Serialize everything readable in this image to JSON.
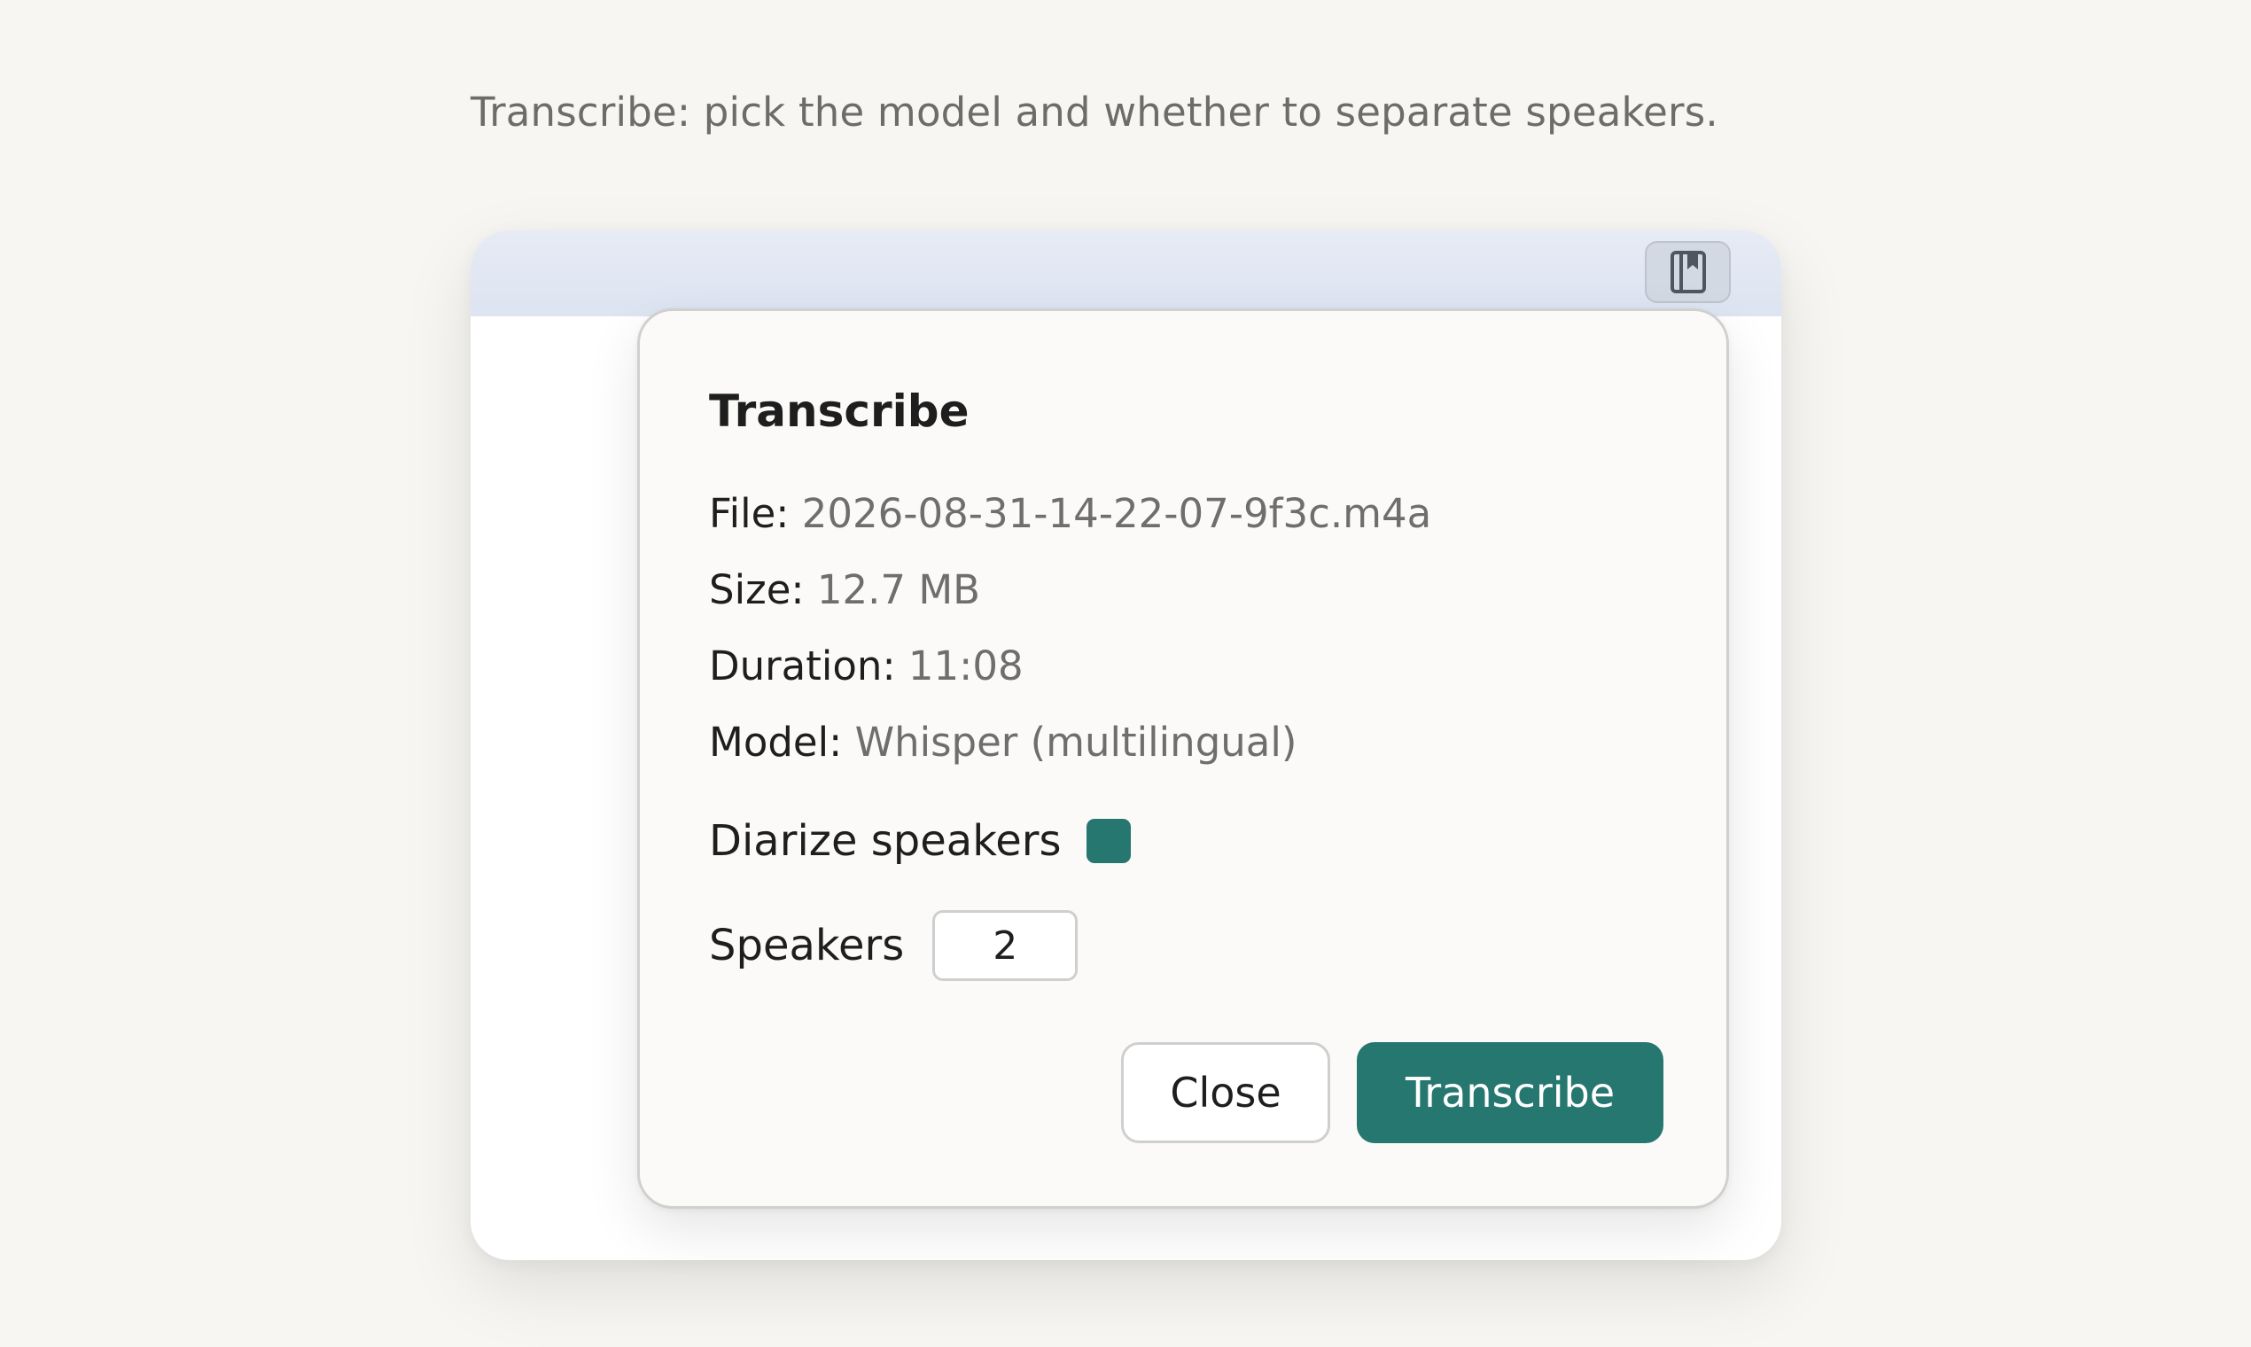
{
  "instruction": "Transcribe: pick the model and whether to separate speakers.",
  "window": {
    "toolbar_icon": "bookmark-book-icon"
  },
  "dialog": {
    "title": "Transcribe",
    "file_label": "File:",
    "file_value": "2026-08-31-14-22-07-9f3c.m4a",
    "size_label": "Size:",
    "size_value": "12.7 MB",
    "duration_label": "Duration:",
    "duration_value": "11:08",
    "model_label": "Model:",
    "model_value": "Whisper (multilingual)",
    "diarize_label": "Diarize speakers",
    "diarize_checked": true,
    "speakers_label": "Speakers",
    "speakers_value": "2",
    "close_label": "Close",
    "transcribe_label": "Transcribe"
  },
  "colors": {
    "accent": "#26776f",
    "background": "#f7f6f3",
    "titlebar": "#e1e7f3"
  }
}
